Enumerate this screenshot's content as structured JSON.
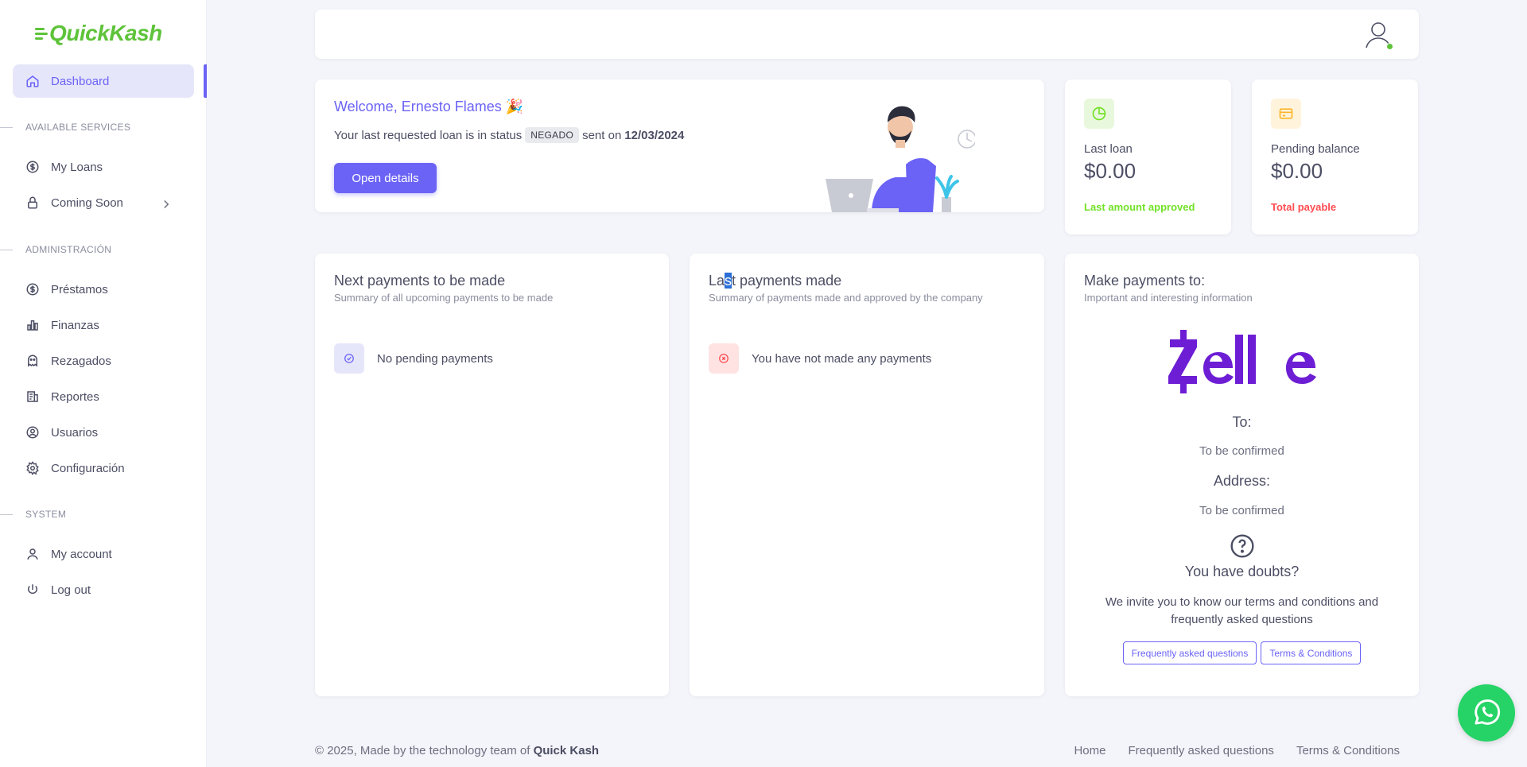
{
  "brand": {
    "logo_text": "QuickKash",
    "accent": "#6b63f5",
    "success": "#5ec33a",
    "danger": "#ff4c51",
    "warning": "#fdb528"
  },
  "sidebar": {
    "active_item": {
      "label": "Dashboard",
      "icon": "home-icon"
    },
    "sections": [
      {
        "title": "AVAILABLE SERVICES"
      },
      {
        "title": "ADMINISTRACIÓN"
      },
      {
        "title": "SYSTEM"
      }
    ],
    "items": [
      {
        "label": "My Loans",
        "icon": "dollar-circle-icon"
      },
      {
        "label": "Coming Soon",
        "icon": "lock-icon"
      },
      {
        "label": "Préstamos",
        "icon": "dollar-circle-icon"
      },
      {
        "label": "Finanzas",
        "icon": "bar-chart-icon"
      },
      {
        "label": "Rezagados",
        "icon": "ghost-icon"
      },
      {
        "label": "Reportes",
        "icon": "report-icon"
      },
      {
        "label": "Usuarios",
        "icon": "user-circle-icon"
      },
      {
        "label": "Configuración",
        "icon": "gear-icon"
      },
      {
        "label": "My account",
        "icon": "user-icon"
      },
      {
        "label": "Log out",
        "icon": "power-icon"
      }
    ]
  },
  "welcome": {
    "title": "Welcome, Ernesto Flames 🎉",
    "line_prefix": "Your last requested loan is in status",
    "status": "NEGADO",
    "line_middle": "sent on",
    "date": "12/03/2024",
    "button_label": "Open details"
  },
  "stats": [
    {
      "label": "Last loan",
      "value": "$0.00",
      "sub": "Last amount approved",
      "color": "#72e128",
      "icon": "pie-chart-icon"
    },
    {
      "label": "Pending balance",
      "value": "$0.00",
      "sub": "Total payable",
      "color": "#ff4c51",
      "icon": "credit-card-icon"
    }
  ],
  "next_payments": {
    "title": "Next payments to be made",
    "subtitle": "Summary of all upcoming payments to be made",
    "status_text": "No pending payments"
  },
  "last_payments": {
    "title_a": "La",
    "title_hl": "s",
    "title_b": "t payments made",
    "subtitle": "Summary of payments made and approved by the company",
    "status_text": "You have not made any payments"
  },
  "make_payments": {
    "title": "Make payments to:",
    "subtitle": "Important and interesting information",
    "to_label": "To:",
    "to_value": "To be confirmed",
    "address_label": "Address:",
    "address_value": "To be confirmed",
    "doubts_title": "You have doubts?",
    "doubts_text": "We invite you to know our terms and conditions and frequently asked questions",
    "faq_button": "Frequently asked questions",
    "terms_button": "Terms & Conditions"
  },
  "footer": {
    "prefix": "© 2025, Made by the technology team of",
    "brand": "Quick Kash",
    "links": [
      "Home",
      "Frequently asked questions",
      "Terms & Conditions"
    ]
  }
}
